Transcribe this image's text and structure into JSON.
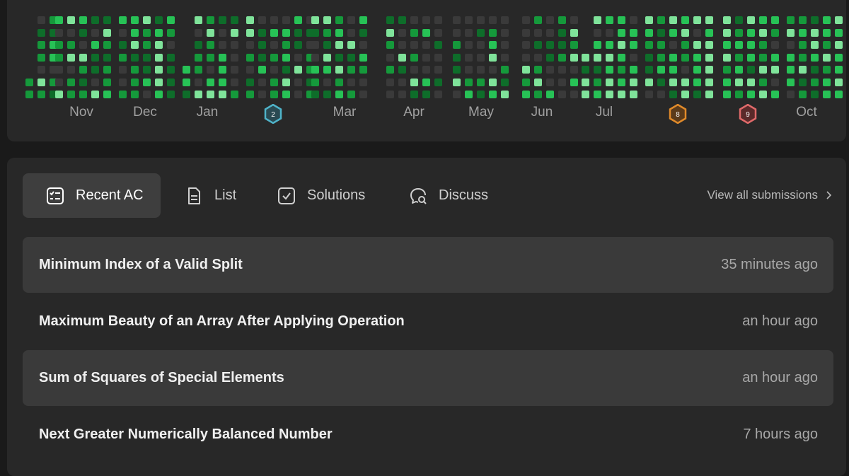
{
  "heatmap": {
    "colors": {
      "empty": "#3a3a3a",
      "level1": "#0e6d2a",
      "level2": "#15993b",
      "level3": "#27c256",
      "level4": "#7fe39a"
    },
    "months": [
      "Nov",
      "Dec",
      "Jan",
      "Mar",
      "Apr",
      "May",
      "Jun",
      "Jul",
      "Oct"
    ],
    "badges": [
      {
        "label": "2",
        "color": "#4fb3c9"
      },
      {
        "label": "8",
        "color": "#e08a2a"
      },
      {
        "label": "9",
        "color": "#e06a6a"
      }
    ]
  },
  "tabs": [
    {
      "label": "Recent AC",
      "icon": "checklist-icon",
      "active": true
    },
    {
      "label": "List",
      "icon": "document-icon",
      "active": false
    },
    {
      "label": "Solutions",
      "icon": "checkbox-icon",
      "active": false
    },
    {
      "label": "Discuss",
      "icon": "chat-search-icon",
      "active": false
    }
  ],
  "view_all": {
    "label": "View all submissions",
    "icon": "chevron-right-icon"
  },
  "submissions": [
    {
      "title": "Minimum Index of a Valid Split",
      "time": "35 minutes ago"
    },
    {
      "title": "Maximum Beauty of an Array After Applying Operation",
      "time": "an hour ago"
    },
    {
      "title": "Sum of Squares of Special Elements",
      "time": "an hour ago"
    },
    {
      "title": "Next Greater Numerically Balanced Number",
      "time": "7 hours ago"
    }
  ]
}
